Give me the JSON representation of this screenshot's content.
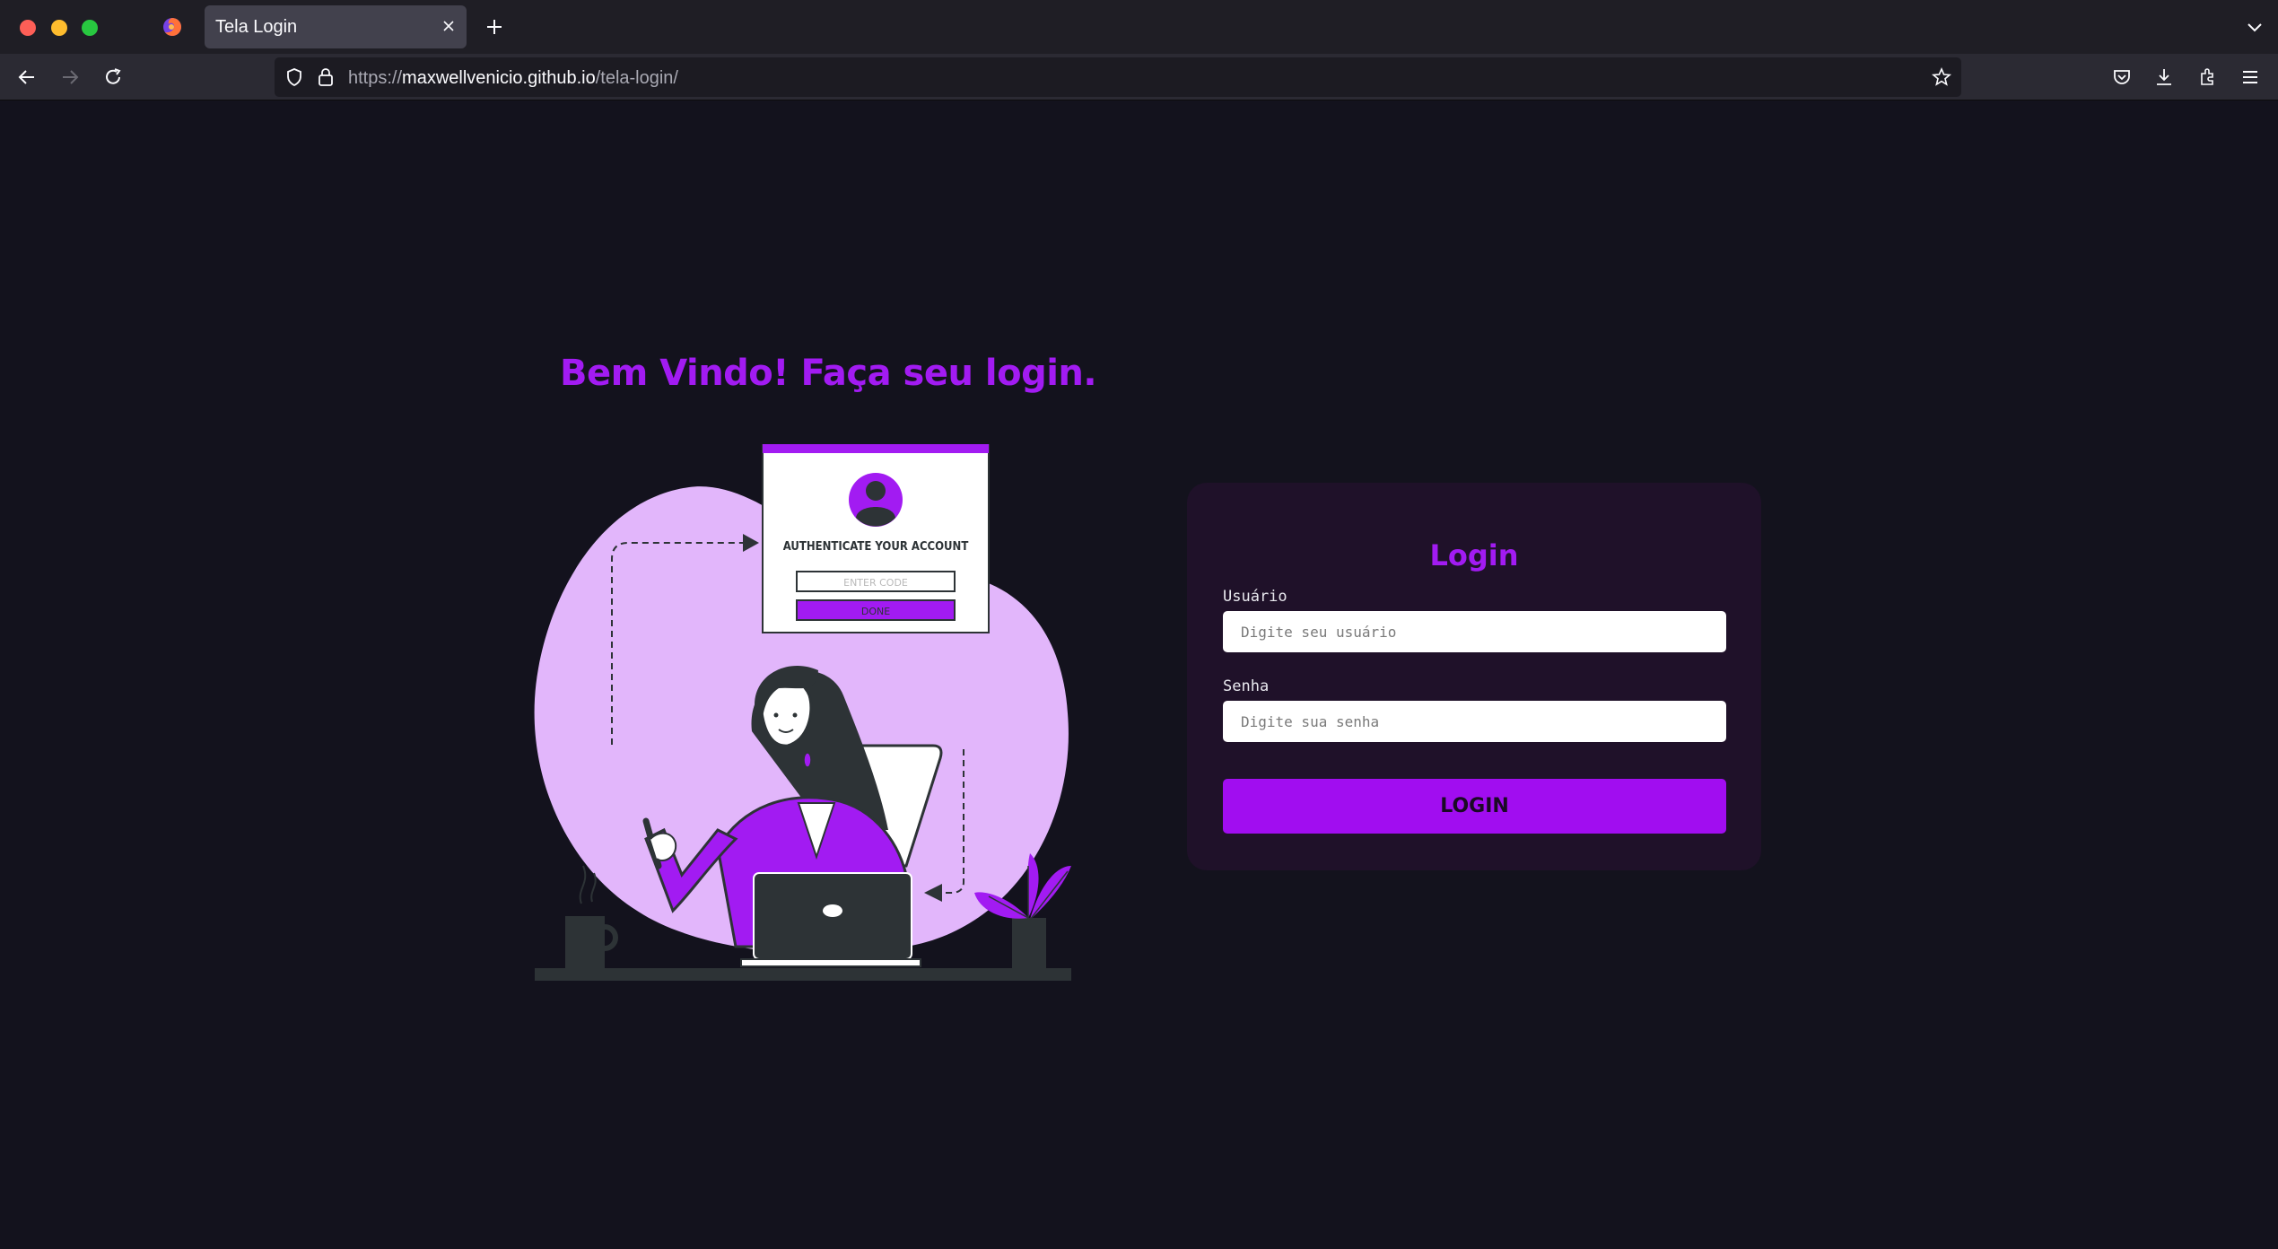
{
  "browser": {
    "tab_title": "Tela Login",
    "url_prefix": "https://",
    "url_host": "maxwellvenicio.github.io",
    "url_path": "/tela-login/"
  },
  "page": {
    "welcome": "Bem Vindo! Faça seu login.",
    "illustration": {
      "card_title": "AUTHENTICATE YOUR ACCOUNT",
      "code_placeholder": "ENTER CODE",
      "done_label": "DONE"
    },
    "login": {
      "title": "Login",
      "username_label": "Usuário",
      "username_placeholder": "Digite seu usuário",
      "password_label": "Senha",
      "password_placeholder": "Digite sua senha",
      "button_label": "LOGIN"
    }
  },
  "colors": {
    "accent": "#a21bf2",
    "background": "#13121d",
    "card": "#1f1129",
    "blob": "#e2b6fb"
  }
}
